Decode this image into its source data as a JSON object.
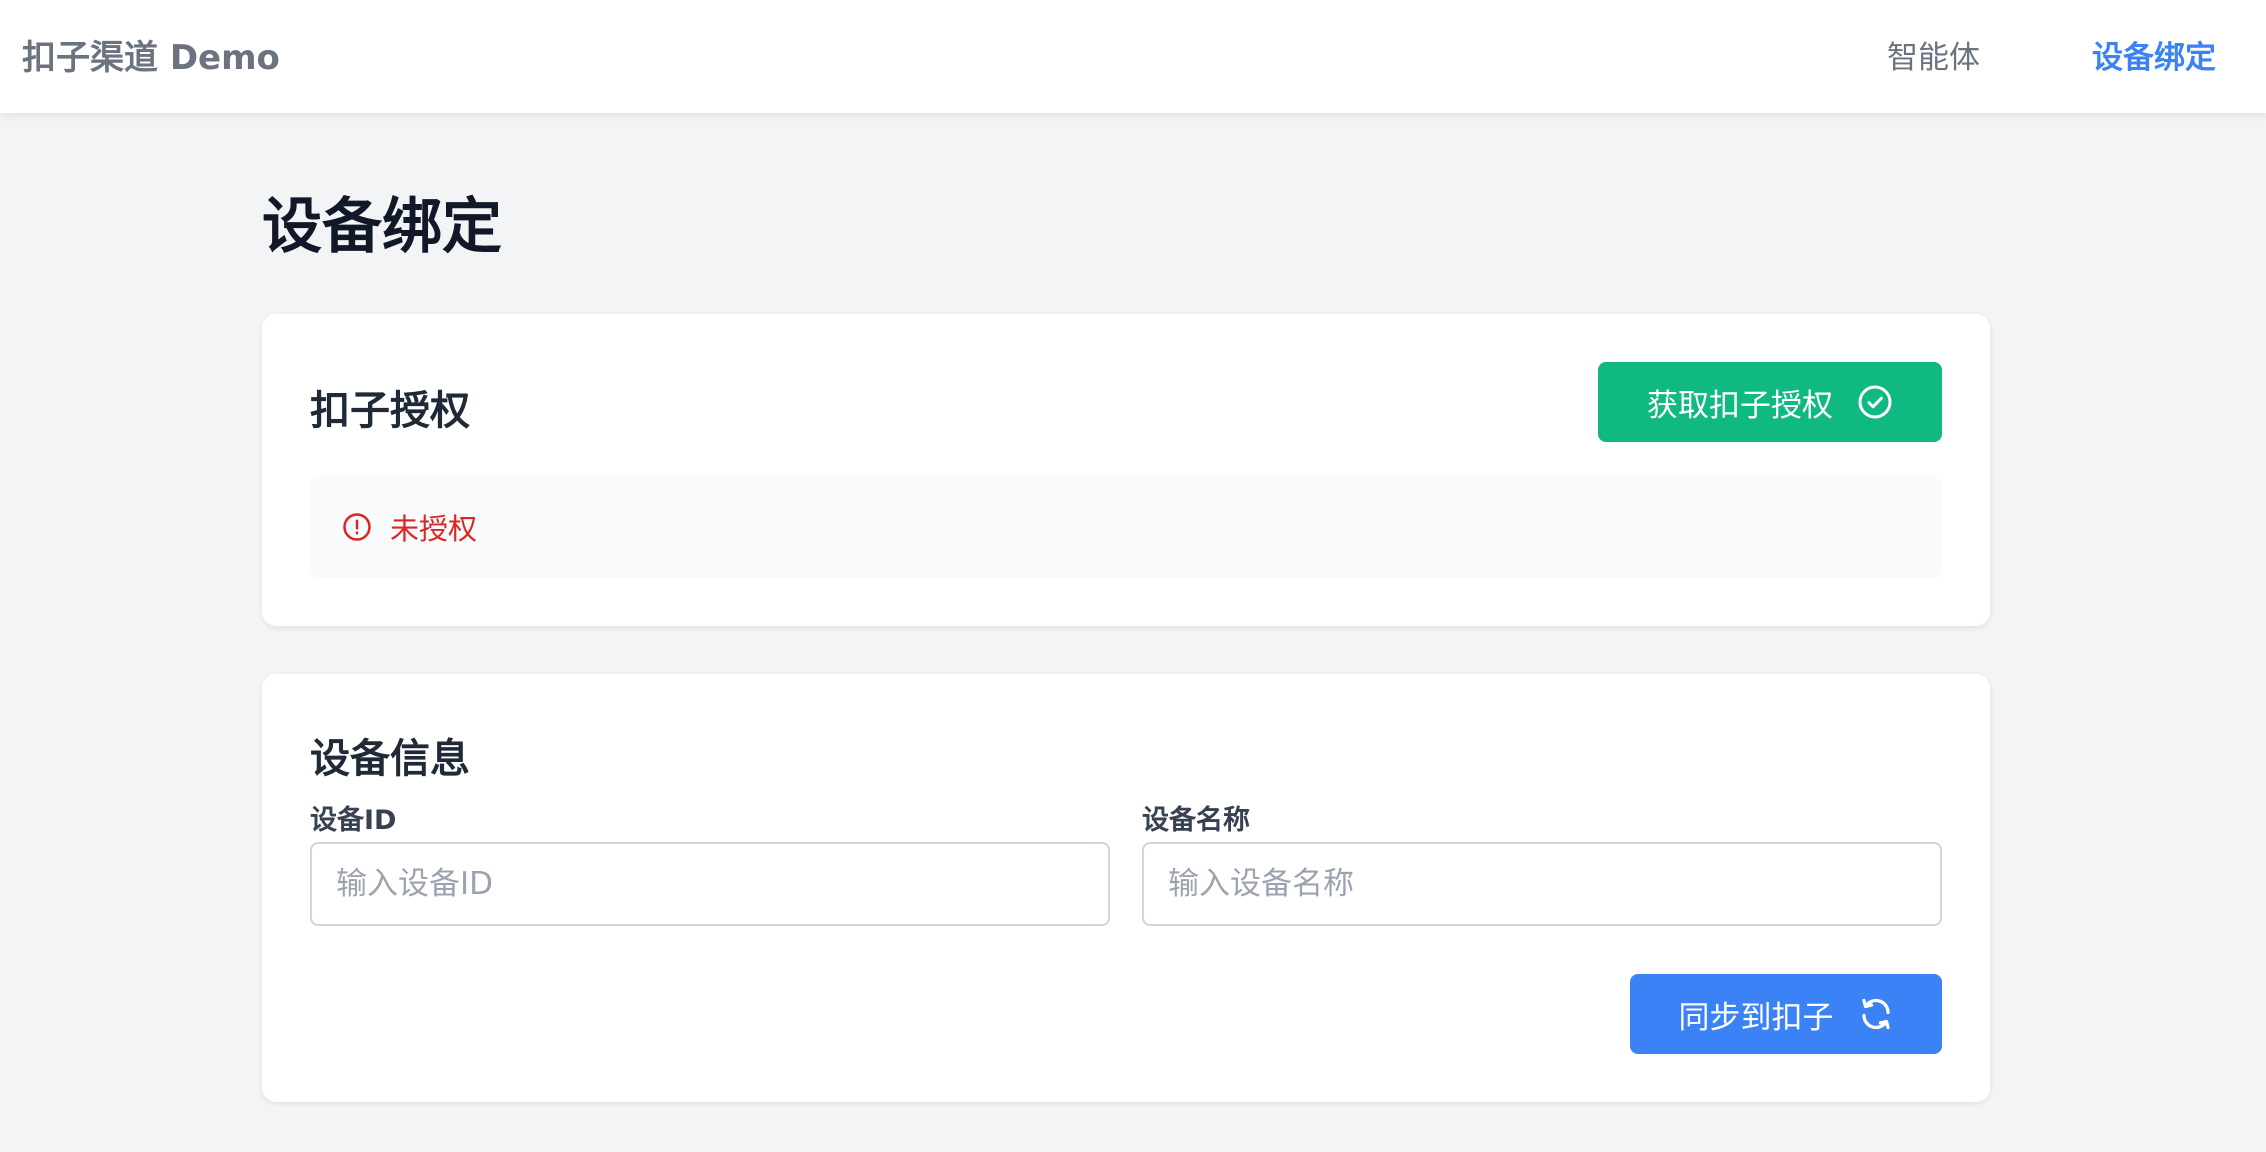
{
  "header": {
    "brand": "扣子渠道 Demo",
    "nav": [
      {
        "label": "智能体",
        "active": false
      },
      {
        "label": "设备绑定",
        "active": true
      }
    ]
  },
  "page": {
    "title": "设备绑定"
  },
  "auth_card": {
    "title": "扣子授权",
    "button_label": "获取扣子授权",
    "button_icon": "check-circle-icon",
    "status_icon": "alert-circle-icon",
    "status_text": "未授权"
  },
  "device_card": {
    "title": "设备信息",
    "id_label": "设备ID",
    "id_placeholder": "输入设备ID",
    "id_value": "",
    "name_label": "设备名称",
    "name_placeholder": "输入设备名称",
    "name_value": "",
    "sync_label": "同步到扣子",
    "sync_icon": "refresh-icon"
  },
  "colors": {
    "accent": "#3b82f6",
    "success": "#10b981",
    "error": "#dc2626"
  }
}
